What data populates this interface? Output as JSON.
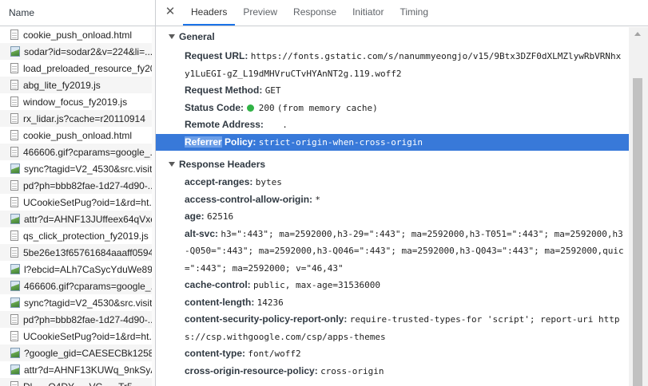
{
  "list": {
    "header": "Name",
    "items": [
      {
        "label": "cookie_push_onload.html",
        "icon": "file-icon"
      },
      {
        "label": "sodar?id=sodar2&v=224&li=...",
        "icon": "image-icon"
      },
      {
        "label": "load_preloaded_resource_fy20...",
        "icon": "file-icon"
      },
      {
        "label": "abg_lite_fy2019.js",
        "icon": "file-icon"
      },
      {
        "label": "window_focus_fy2019.js",
        "icon": "file-icon"
      },
      {
        "label": "rx_lidar.js?cache=r20110914",
        "icon": "file-icon"
      },
      {
        "label": "cookie_push_onload.html",
        "icon": "file-icon"
      },
      {
        "label": "466606.gif?cparams=google_...",
        "icon": "file-icon"
      },
      {
        "label": "sync?tagid=V2_4530&src.visit...",
        "icon": "image-icon"
      },
      {
        "label": "pd?ph=bbb82fae-1d27-4d90-...",
        "icon": "file-icon"
      },
      {
        "label": "UCookieSetPug?oid=1&rd=ht...",
        "icon": "file-icon"
      },
      {
        "label": "attr?d=AHNF13JUffeex64qVxe...",
        "icon": "image-icon"
      },
      {
        "label": "qs_click_protection_fy2019.js",
        "icon": "file-icon"
      },
      {
        "label": "5be26e13f65761684aaaff0594...",
        "icon": "file-icon"
      },
      {
        "label": "l?ebcid=ALh7CaSycYduWe89...",
        "icon": "image-icon"
      },
      {
        "label": "466606.gif?cparams=google_...",
        "icon": "image-icon"
      },
      {
        "label": "sync?tagid=V2_4530&src.visit...",
        "icon": "image-icon"
      },
      {
        "label": "pd?ph=bbb82fae-1d27-4d90-...",
        "icon": "file-icon"
      },
      {
        "label": "UCookieSetPug?oid=1&rd=ht...",
        "icon": "file-icon"
      },
      {
        "label": "?google_gid=CAESECBk1258...",
        "icon": "image-icon"
      },
      {
        "label": "attr?d=AHNF13KUWq_9nkSyA...",
        "icon": "image-icon"
      },
      {
        "label": "Dl......Q4DY......VC......Tr5...",
        "icon": "file-icon"
      }
    ]
  },
  "tabs": [
    "Headers",
    "Preview",
    "Response",
    "Initiator",
    "Timing"
  ],
  "active_tab": "Headers",
  "close_glyph": "✕",
  "general": {
    "title": "General",
    "request_url_label": "Request URL:",
    "request_url_value": "https://fonts.gstatic.com/s/nanummyeongjo/v15/9Btx3DZF0dXLMZlywRbVRNhxy1LuEGI-gZ_L19dMHVruCTvHYAnNT2g.119.woff2",
    "request_method_label": "Request Method:",
    "request_method_value": "GET",
    "status_code_label": "Status Code:",
    "status_code_value": "200",
    "status_code_note": "(from memory cache)",
    "remote_address_label": "Remote Address:",
    "remote_address_value": ".",
    "referrer_policy_label_hl": "Referrer",
    "referrer_policy_label_rest": " Policy:",
    "referrer_policy_value": "strict-origin-when-cross-origin"
  },
  "response_headers": {
    "title": "Response Headers",
    "items": [
      {
        "key": "accept-ranges:",
        "value": "bytes"
      },
      {
        "key": "access-control-allow-origin:",
        "value": "*"
      },
      {
        "key": "age:",
        "value": "62516"
      },
      {
        "key": "alt-svc:",
        "value": "h3=\":443\"; ma=2592000,h3-29=\":443\"; ma=2592000,h3-T051=\":443\"; ma=2592000,h3-Q050=\":443\"; ma=2592000,h3-Q046=\":443\"; ma=2592000,h3-Q043=\":443\"; ma=2592000,quic=\":443\"; ma=2592000; v=\"46,43\""
      },
      {
        "key": "cache-control:",
        "value": "public, max-age=31536000"
      },
      {
        "key": "content-length:",
        "value": "14236"
      },
      {
        "key": "content-security-policy-report-only:",
        "value": "require-trusted-types-for 'script'; report-uri https://csp.withgoogle.com/csp/apps-themes"
      },
      {
        "key": "content-type:",
        "value": "font/woff2"
      },
      {
        "key": "cross-origin-resource-policy:",
        "value": "cross-origin"
      }
    ]
  },
  "colors": {
    "selection": "#3879d9",
    "tab_active_underline": "#1a73e8",
    "status_ok": "#30b346"
  }
}
